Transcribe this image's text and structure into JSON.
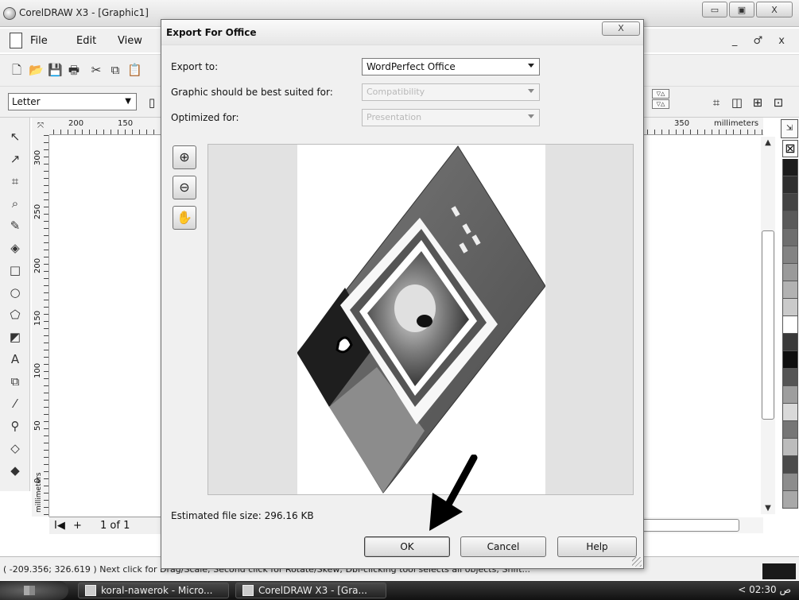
{
  "app": {
    "title": "CorelDRAW X3 - [Graphic1]",
    "window_controls": [
      "▭",
      "▣",
      "X"
    ]
  },
  "menu": {
    "file": "File",
    "edit": "Edit",
    "view": "View",
    "mdi_controls": "_ ♂ x"
  },
  "property_bar": {
    "paper_size": "Letter"
  },
  "ruler": {
    "h_labels": [
      "200",
      "150",
      "350"
    ],
    "unit": "millimeters",
    "v_labels": [
      "300",
      "250",
      "200",
      "150",
      "100",
      "50",
      "0"
    ],
    "v_unit": "millimeters"
  },
  "page_nav": {
    "first": "I◀",
    "add": "+",
    "page": "1 of 1"
  },
  "status": {
    "text": "( -209.356; 326.619 )  Next click for Drag/Scale; Second click for Rotate/Skew; Dbl-clicking tool selects all objects; Shift..."
  },
  "taskbar": {
    "items": [
      "koral-nawerok - Micro...",
      "CorelDRAW X3 - [Gra..."
    ],
    "clock": "< 02:30 ص"
  },
  "dialog": {
    "title": "Export For Office",
    "close": "X",
    "export_to": {
      "label": "Export to:",
      "value": "WordPerfect Office"
    },
    "suited_for": {
      "label": "Graphic should be best suited for:",
      "value": "Compatibility"
    },
    "optimized_for": {
      "label": "Optimized for:",
      "value": "Presentation"
    },
    "file_size": "Estimated file size: 296.16 KB",
    "buttons": {
      "ok": "OK",
      "cancel": "Cancel",
      "help": "Help"
    }
  },
  "palette_colors": [
    "#1c1c1c",
    "#2f2f2f",
    "#444444",
    "#5a5a5a",
    "#6e6e6e",
    "#838383",
    "#9a9a9a",
    "#b2b2b2",
    "#cacaca",
    "#ffffff",
    "#3a3a3a",
    "#0f0f0f",
    "#555555",
    "#9e9e9e",
    "#d9d9d9",
    "#767676",
    "#bcbcbc",
    "#4b4b4b",
    "#8c8c8c",
    "#a8a8a8"
  ],
  "icons": [
    "gear-icon",
    "zoom-in-icon",
    "zoom-out-icon",
    "pan-hand-icon",
    "arrow-down-icon"
  ]
}
